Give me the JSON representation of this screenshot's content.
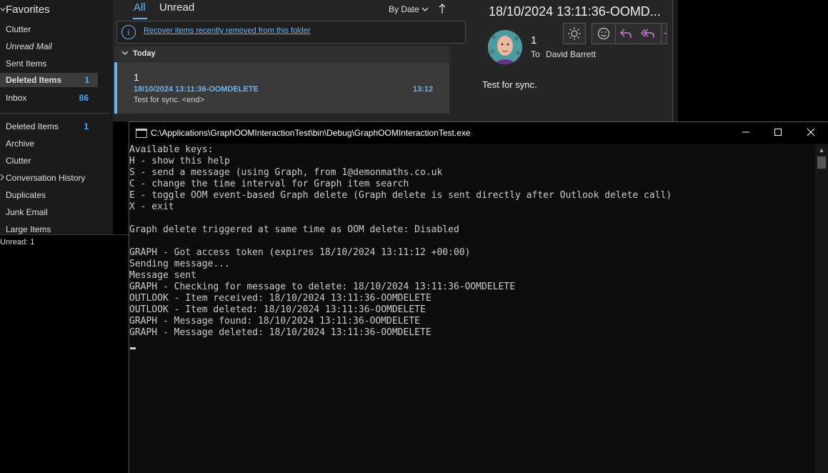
{
  "folder_pane": {
    "favorites_label": "Favorites",
    "favorites": [
      {
        "label": "Clutter",
        "count": ""
      },
      {
        "label": "Unread Mail",
        "count": ""
      },
      {
        "label": "Sent Items",
        "count": ""
      },
      {
        "label": "Deleted Items",
        "count": "1"
      },
      {
        "label": "Inbox",
        "count": "86"
      }
    ],
    "folders": [
      {
        "label": "Deleted Items",
        "count": "1"
      },
      {
        "label": "Archive",
        "count": ""
      },
      {
        "label": "Clutter",
        "count": ""
      },
      {
        "label": "Conversation History",
        "count": ""
      },
      {
        "label": "Duplicates",
        "count": ""
      },
      {
        "label": "Junk Email",
        "count": ""
      },
      {
        "label": "Large Items",
        "count": ""
      }
    ]
  },
  "status_bar": {
    "text": "Unread: 1"
  },
  "message_list": {
    "tabs": [
      "All",
      "Unread"
    ],
    "sort_label": "By Date",
    "info_link": "Recover items recently removed from this folder",
    "group_label": "Today",
    "items": [
      {
        "sender": "1",
        "subject": "18/10/2024 13:11:36-OOMDELETE",
        "time": "13:12",
        "preview": "Test for sync. <end>"
      }
    ]
  },
  "reading_pane": {
    "subject": "18/10/2024 13:11:36-OOMD...",
    "from": "1",
    "to_label": "To",
    "to": "David Barrett",
    "body": "Test for sync."
  },
  "console": {
    "title": "C:\\Applications\\GraphOOMInteractionTest\\bin\\Debug\\GraphOOMInteractionTest.exe",
    "lines": [
      "Available keys:",
      "H - show this help",
      "S - send a message (using Graph, from 1@demonmaths.co.uk",
      "C - change the time interval for Graph item search",
      "E - toggle OOM event-based Graph delete (Graph delete is sent directly after Outlook delete call)",
      "X - exit",
      "",
      "Graph delete triggered at same time as OOM delete: Disabled",
      "",
      "GRAPH - Got access token (expires 18/10/2024 13:11:12 +00:00)",
      "Sending message...",
      "Message sent",
      "GRAPH - Checking for message to delete: 18/10/2024 13:11:36-OOMDELETE",
      "OUTLOOK - Item received: 18/10/2024 13:11:36-OOMDELETE",
      "OUTLOOK - Item deleted: 18/10/2024 13:11:36-OOMDELETE",
      "GRAPH - Message found: 18/10/2024 13:11:36-OOMDELETE",
      "GRAPH - Message deleted: 18/10/2024 13:11:36-OOMDELETE"
    ]
  },
  "colors": {
    "accent": "#6ab4f5",
    "console_bg": "#0c0c0c",
    "console_text": "#cccccc"
  },
  "icons": [
    "info-icon",
    "sun-icon",
    "smiley-icon",
    "reply-icon",
    "reply-all-icon",
    "minimize-icon",
    "maximize-icon",
    "close-icon",
    "console-app-icon"
  ]
}
